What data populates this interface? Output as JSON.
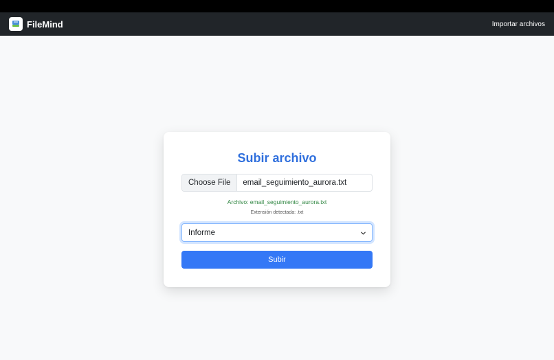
{
  "navbar": {
    "brand": "FileMind",
    "link": "Importar archivos"
  },
  "upload": {
    "title": "Subir archivo",
    "choose_label": "Choose File",
    "file_name": "email_seguimiento_aurora.txt",
    "file_info": "Archivo: email_seguimiento_aurora.txt",
    "extension_info": "Extensión detectada: .txt",
    "type_selected": "Informe",
    "submit_label": "Subir"
  },
  "colors": {
    "navbar_bg": "#212529",
    "accent": "#3478f6",
    "title": "#2f6fdd",
    "success_text": "#2e8540"
  },
  "icons": {
    "logo": "filemind-logo-icon",
    "select_arrow": "chevron-down-icon"
  }
}
